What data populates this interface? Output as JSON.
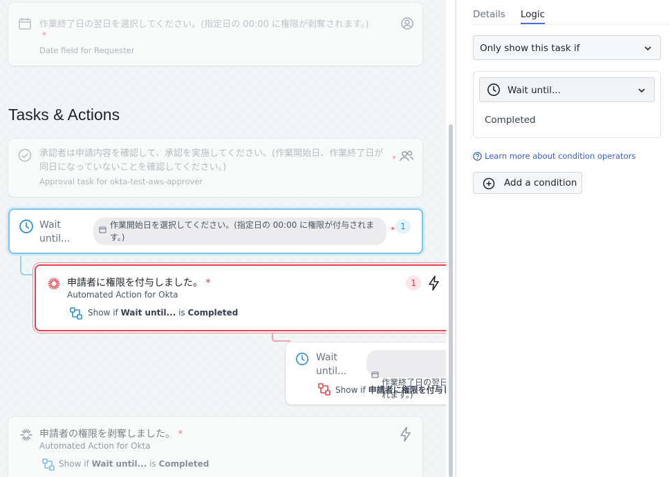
{
  "canvas": {
    "date_card": {
      "title": "作業終了日の翌日を選択してください。(指定日の 00:00 に権限が剥奪されます。)",
      "required_mark": "*",
      "subtitle": "Date field for Requester",
      "icons": [
        "calendar-icon",
        "user-circle-icon"
      ]
    },
    "section_title": "Tasks & Actions",
    "approval_card": {
      "title": "承認者は申請内容を確認して、承認を実施してください。(作業開始日、作業終了日が同日になっていないことを確認してください。)",
      "required_mark": "*",
      "subtitle": "Approval task for okta-test-aws-approver",
      "icons": [
        "check-circle-icon",
        "people-icon"
      ]
    },
    "wait_card_1": {
      "name": "Wait until...",
      "chip_text": "作業開始日を選択してください。(指定日の 00:00 に権限が付与されます。)",
      "required_mark": "*",
      "count": "1"
    },
    "action_card_1": {
      "title": "申請者に権限を付与しました。",
      "required_mark": "*",
      "subtitle": "Automated Action for Okta",
      "show_prefix": "Show if",
      "show_task": "Wait until...",
      "show_is": "is",
      "show_status": "Completed",
      "count": "1"
    },
    "wait_card_2": {
      "name": "Wait until...",
      "chip_text": "作業終了日の翌日\nれます。)",
      "show_prefix": "Show if",
      "show_task": "申請者に権限を付与し"
    },
    "action_card_2": {
      "title": "申請者の権限を剥奪しました。",
      "required_mark": "*",
      "subtitle": "Automated Action for Okta",
      "show_prefix": "Show if",
      "show_task": "Wait until...",
      "show_is": "is",
      "show_status": "Completed"
    }
  },
  "panel": {
    "tabs": [
      {
        "label": "Details",
        "active": false
      },
      {
        "label": "Logic",
        "active": true
      }
    ],
    "visibility_select": "Only show this task if",
    "condition": {
      "task_select": "Wait until...",
      "status": "Completed"
    },
    "help_link": "Learn more about condition operators",
    "add_condition_button": "Add a condition"
  },
  "colors": {
    "accent_blue": "#7cc4ec",
    "error_red": "#e8424f",
    "link_blue": "#3a5fc8",
    "tab_underline": "#4f6bd8"
  }
}
